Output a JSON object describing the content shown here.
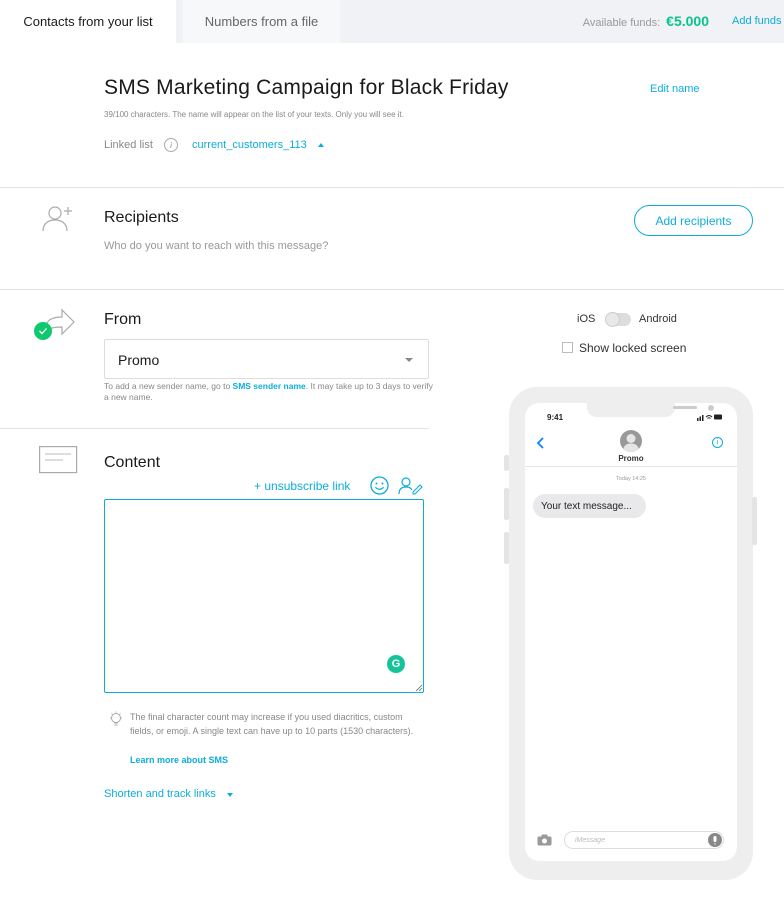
{
  "tabs": [
    {
      "label": "Contacts from your list"
    },
    {
      "label": "Numbers from a file"
    }
  ],
  "funds": {
    "label": "Available funds:",
    "amount": "€5.000",
    "add_label": "Add funds"
  },
  "campaign": {
    "name": "SMS Marketing Campaign for Black Friday",
    "edit_label": "Edit name",
    "hint": "39/100 characters. The name will appear on the list of your texts. Only you will see it.",
    "linked_label": "Linked list",
    "linked_value": "current_customers_113"
  },
  "recipients": {
    "title": "Recipients",
    "subtitle": "Who do you want to reach with this message?",
    "button": "Add recipients"
  },
  "from": {
    "title": "From",
    "sender": "Promo",
    "note_pre": "To add a new sender name, go to ",
    "note_link": "SMS sender name",
    "note_post": ". It may take up to 3 days to verify a new name."
  },
  "content": {
    "title": "Content",
    "unsubscribe_label": "+ unsubscribe link",
    "message": "",
    "final_note": "The final character count may increase if you used diacritics, custom fields, or emoji. A single text can have up to 10 parts (1530 characters).",
    "learn_more": "Learn more about SMS",
    "shorten_label": "Shorten and track links"
  },
  "preview": {
    "ios_label": "iOS",
    "android_label": "Android",
    "locked_label": "Show locked screen",
    "clock": "9:41",
    "contact": "Promo",
    "time": "Today 14:25",
    "bubble": "Your text message...",
    "input_placeholder": "iMessage"
  },
  "colors": {
    "accent": "#0dadd8",
    "funds_green": "#0ac28f",
    "check_green": "#0fc96f"
  }
}
